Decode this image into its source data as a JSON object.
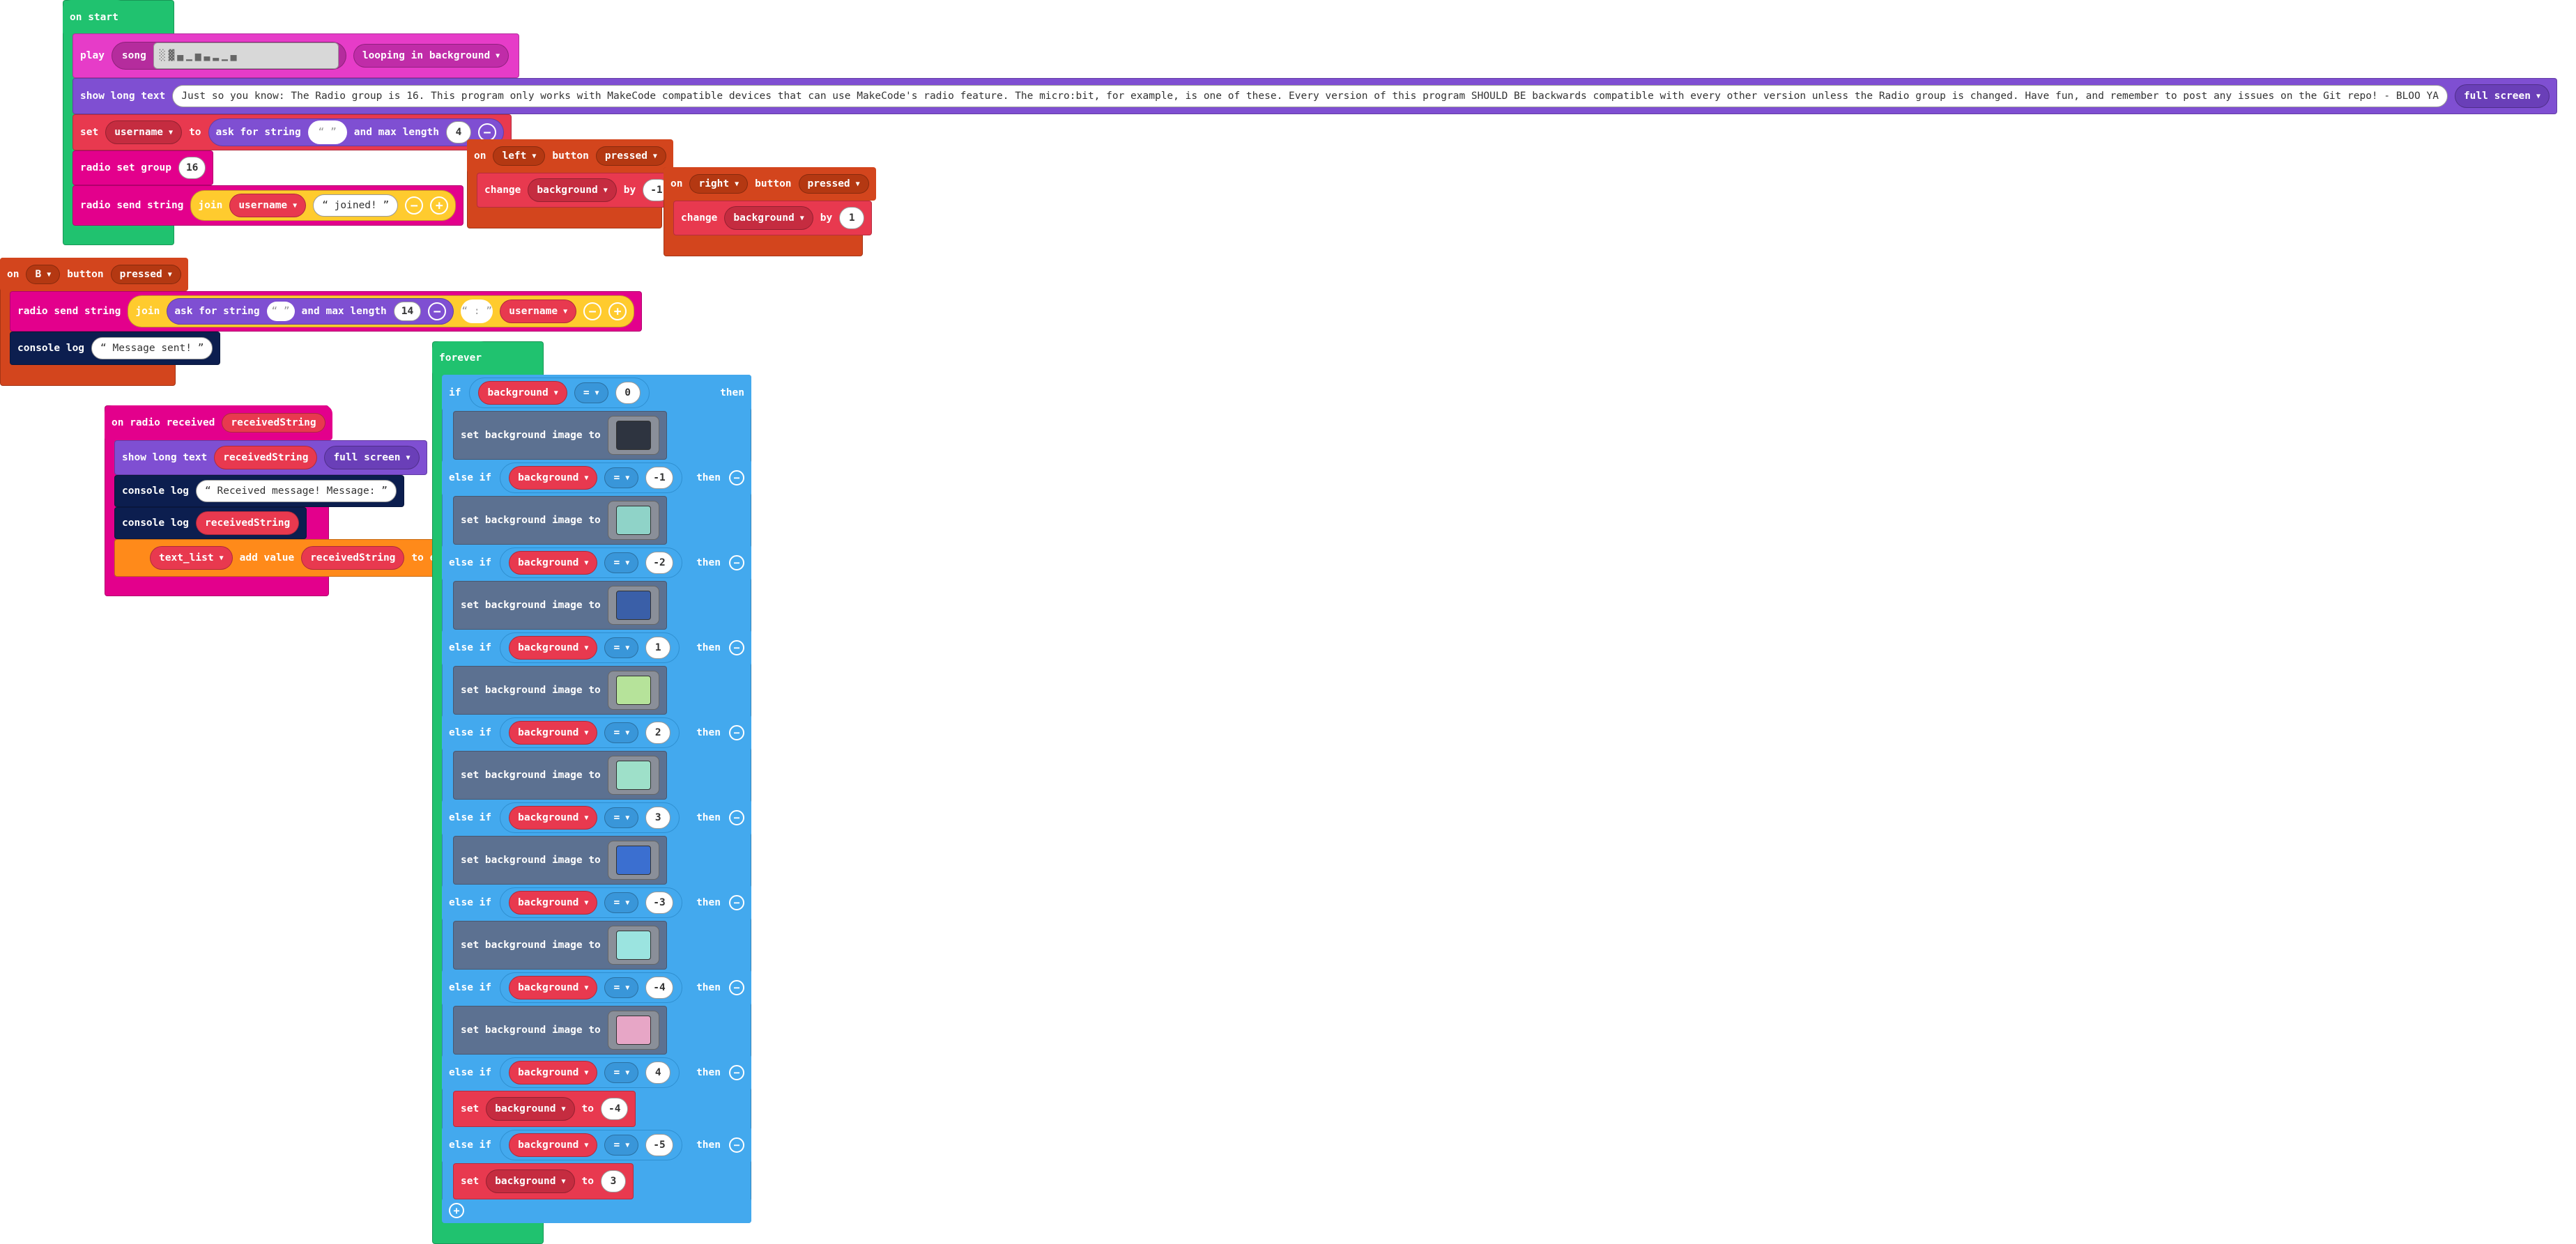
{
  "colors": {
    "loops": "#20c26f",
    "music": "#e63cc8",
    "basic": "#7f4fd2",
    "vars": "#e8394f",
    "radio": "#e3008c",
    "text": "#ffcb2e",
    "events": "#d3451d",
    "console": "#0c1e4f",
    "logic": "#43a9ee",
    "image": "#5c7191",
    "arrays": "#ff8a1a"
  },
  "on_start": {
    "header": "on start",
    "play": "play",
    "song": "song",
    "song_value": "░▓▄▁▅▃▂▁▄",
    "looping": "looping in background",
    "show_long_text": "show long text",
    "long_text": "Just so you know: The Radio group is 16. This program only works with MakeCode compatible devices that can use MakeCode's radio feature. The micro:bit, for example, is one of these. Every version of this program SHOULD BE backwards compatible with every other version unless the Radio group is changed. Have fun, and remember to post any issues on the Git repo! - BLOO YA",
    "full_screen": "full screen",
    "set": "set",
    "var_username": "username",
    "to": "to",
    "ask_for_string": "ask for string",
    "ask_value": "“ ”",
    "and_max_length": "and max length",
    "max_len": "4",
    "radio_set_group": "radio set group",
    "group": "16",
    "radio_send_string": "radio send string",
    "join": "join",
    "joined_text": "“ joined! ”"
  },
  "on_left": {
    "on": "on",
    "button": "left",
    "button_word": "button",
    "pressed": "pressed",
    "change": "change",
    "var": "background",
    "by": "by",
    "amount": "-1"
  },
  "on_right": {
    "on": "on",
    "button": "right",
    "button_word": "button",
    "pressed": "pressed",
    "change": "change",
    "var": "background",
    "by": "by",
    "amount": "1"
  },
  "on_b": {
    "on": "on",
    "button": "B",
    "button_word": "button",
    "pressed": "pressed",
    "radio_send_string": "radio send string",
    "join": "join",
    "ask_for_string": "ask for string",
    "ask_value": "“ ”",
    "and_max_length": "and max length",
    "max_len": "14",
    "sep": "“ : ”",
    "var": "username",
    "console_log": "console log",
    "log_text": "“ Message sent! ”"
  },
  "on_radio": {
    "header": "on radio received",
    "param": "receivedString",
    "show_long_text": "show long text",
    "var": "receivedString",
    "full_screen": "full screen",
    "console_log": "console log",
    "msg": "“ Received message! Message: ”",
    "list": "text_list",
    "add_value": "add value",
    "to_end": "to end"
  },
  "forever": {
    "header": "forever",
    "if": "if",
    "else_if": "else if",
    "then": "then",
    "eq": "=",
    "var": "background",
    "set_bg_image": "set background image to",
    "set": "set",
    "to": "to",
    "cases": [
      {
        "value": "0",
        "kind": "img",
        "thumb": "#2e3440"
      },
      {
        "value": "-1",
        "kind": "img",
        "thumb": "#8fd3c8"
      },
      {
        "value": "-2",
        "kind": "img",
        "thumb": "#3a5fa8"
      },
      {
        "value": "1",
        "kind": "img",
        "thumb": "#b6e39a"
      },
      {
        "value": "2",
        "kind": "img",
        "thumb": "#9ee0c9"
      },
      {
        "value": "3",
        "kind": "img",
        "thumb": "#3b6fd0"
      },
      {
        "value": "-3",
        "kind": "img",
        "thumb": "#9be4e0"
      },
      {
        "value": "-4",
        "kind": "img",
        "thumb": "#e7a6c6"
      },
      {
        "value": "4",
        "kind": "set",
        "set_value": "-4"
      },
      {
        "value": "-5",
        "kind": "set",
        "set_value": "3"
      }
    ]
  }
}
